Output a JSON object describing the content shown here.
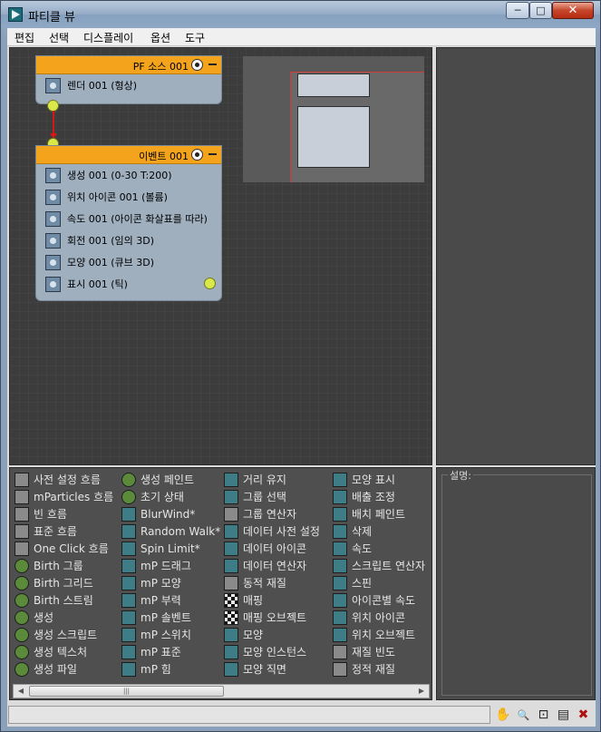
{
  "window": {
    "title": "파티클 뷰",
    "minimize": "─",
    "maximize": "□",
    "close": "✕"
  },
  "menu": [
    "편집",
    "선택",
    "디스플레이",
    "옵션",
    "도구"
  ],
  "nodes": {
    "source": {
      "title": "PF 소스 001",
      "operators": [
        {
          "label": "렌더 001 (형상)",
          "icon": "render-icon"
        }
      ]
    },
    "event": {
      "title": "이벤트 001",
      "operators": [
        {
          "label": "생성 001 (0-30 T:200)",
          "icon": "birth-icon"
        },
        {
          "label": "위치 아이콘 001 (볼륨)",
          "icon": "position-icon"
        },
        {
          "label": "속도 001 (아이콘 화살표를 따라)",
          "icon": "speed-icon"
        },
        {
          "label": "회전 001 (임의 3D)",
          "icon": "rotation-icon"
        },
        {
          "label": "모양 001 (큐브 3D)",
          "icon": "shape-icon"
        },
        {
          "label": "표시 001 (틱)",
          "icon": "display-icon"
        }
      ]
    }
  },
  "depot": {
    "columns": [
      [
        {
          "label": "사전 설정 흐름",
          "icon": "flow-icon",
          "style": "gray"
        },
        {
          "label": "mParticles 흐름",
          "icon": "flow-icon",
          "style": "gray"
        },
        {
          "label": "빈 흐름",
          "icon": "flow-icon",
          "style": "gray"
        },
        {
          "label": "표준 흐름",
          "icon": "flow-icon",
          "style": "gray"
        },
        {
          "label": "One Click 흐름",
          "icon": "flow-icon",
          "style": "gray"
        },
        {
          "label": "Birth 그룹",
          "icon": "birth-icon",
          "style": "green"
        },
        {
          "label": "Birth 그리드",
          "icon": "birth-icon",
          "style": "green"
        },
        {
          "label": "Birth 스트림",
          "icon": "birth-icon",
          "style": "green"
        },
        {
          "label": "생성",
          "icon": "birth-icon",
          "style": "green"
        },
        {
          "label": "생성 스크립트",
          "icon": "script-icon",
          "style": "green"
        },
        {
          "label": "생성 텍스처",
          "icon": "texture-icon",
          "style": "green"
        },
        {
          "label": "생성 파일",
          "icon": "file-icon",
          "style": "green"
        }
      ],
      [
        {
          "label": "생성 페인트",
          "icon": "paint-icon",
          "style": "green"
        },
        {
          "label": "초기 상태",
          "icon": "state-icon",
          "style": "green"
        },
        {
          "label": "BlurWind*",
          "icon": "wind-icon",
          "style": "teal"
        },
        {
          "label": "Random Walk*",
          "icon": "walk-icon",
          "style": "teal"
        },
        {
          "label": "Spin Limit*",
          "icon": "spin-icon",
          "style": "teal"
        },
        {
          "label": "mP 드래그",
          "icon": "drag-icon",
          "style": "teal"
        },
        {
          "label": "mP 모양",
          "icon": "shape-icon",
          "style": "teal"
        },
        {
          "label": "mP 부력",
          "icon": "buoyancy-icon",
          "style": "teal"
        },
        {
          "label": "mP 솔벤트",
          "icon": "solvent-icon",
          "style": "teal"
        },
        {
          "label": "mP 스위치",
          "icon": "switch-icon",
          "style": "teal"
        },
        {
          "label": "mP 표준",
          "icon": "standard-icon",
          "style": "teal"
        },
        {
          "label": "mP 힘",
          "icon": "force-icon",
          "style": "teal"
        }
      ],
      [
        {
          "label": "거리 유지",
          "icon": "distance-icon",
          "style": "teal"
        },
        {
          "label": "그룹 선택",
          "icon": "group-select-icon",
          "style": "teal"
        },
        {
          "label": "그룹 연산자",
          "icon": "group-operator-icon",
          "style": "gray"
        },
        {
          "label": "데이터 사전 설정",
          "icon": "data-preset-icon",
          "style": "teal"
        },
        {
          "label": "데이터 아이콘",
          "icon": "data-icon",
          "style": "teal"
        },
        {
          "label": "데이터 연산자",
          "icon": "data-operator-icon",
          "style": "teal"
        },
        {
          "label": "동적 재질",
          "icon": "material-icon",
          "style": "gray"
        },
        {
          "label": "매핑",
          "icon": "mapping-icon",
          "style": "check"
        },
        {
          "label": "매핑 오브젝트",
          "icon": "mapping-object-icon",
          "style": "check"
        },
        {
          "label": "모양",
          "icon": "shape-icon",
          "style": "teal"
        },
        {
          "label": "모양 인스턴스",
          "icon": "shape-instance-icon",
          "style": "teal"
        },
        {
          "label": "모양 직면",
          "icon": "shape-facing-icon",
          "style": "teal"
        }
      ],
      [
        {
          "label": "모양 표시",
          "icon": "shape-mark-icon",
          "style": "teal"
        },
        {
          "label": "배출 조정",
          "icon": "emit-icon",
          "style": "teal"
        },
        {
          "label": "배치 페인트",
          "icon": "placement-icon",
          "style": "teal"
        },
        {
          "label": "삭제",
          "icon": "delete-icon",
          "style": "teal"
        },
        {
          "label": "속도",
          "icon": "speed-icon",
          "style": "teal"
        },
        {
          "label": "스크립트 연산자",
          "icon": "script-icon",
          "style": "teal"
        },
        {
          "label": "스핀",
          "icon": "spin-icon",
          "style": "teal"
        },
        {
          "label": "아이콘별 속도",
          "icon": "speed-by-icon-icon",
          "style": "teal"
        },
        {
          "label": "위치 아이콘",
          "icon": "position-icon",
          "style": "teal"
        },
        {
          "label": "위치 오브젝트",
          "icon": "position-object-icon",
          "style": "teal"
        },
        {
          "label": "재질 빈도",
          "icon": "material-icon",
          "style": "gray"
        },
        {
          "label": "정적 재질",
          "icon": "material-icon",
          "style": "gray"
        }
      ]
    ]
  },
  "description": {
    "label": "설명:"
  },
  "scrollbar": {
    "thumb_grip": "|||",
    "left_arrow": "◀",
    "right_arrow": "▶"
  },
  "statusbar": {
    "icons": [
      "pan-icon",
      "zoom-icon",
      "zoom-region-icon",
      "zoom-extents-icon",
      "no-zoom-icon"
    ],
    "glyphs": [
      "✋",
      "🔍",
      "⊡",
      "▤",
      "✖"
    ]
  }
}
